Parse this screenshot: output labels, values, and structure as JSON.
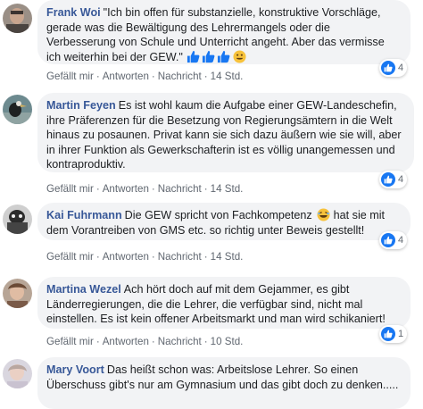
{
  "comments": [
    {
      "author": "Frank Woi",
      "text": "\"Ich bin offen für substanzielle, konstruktive Vorschläge, gerade was die Bewältigung des Lehrermangels oder die Verbesserung von Schule und Unterricht angeht. Aber das vermisse ich weiterhin bei der GEW.\"",
      "like": "Gefällt mir",
      "reply": "Antworten",
      "translate": "Nachricht",
      "time": "14 Std.",
      "reactions": "4"
    },
    {
      "author": "Martin Feyen",
      "text": "Es ist wohl kaum die Aufgabe einer GEW-Landeschefin, ihre Präferenzen für die Besetzung von Regierungsämtern in die Welt hinaus zu posaunen. Privat kann sie sich dazu äußern wie sie will, aber in ihrer Funktion als Gewerkschafterin ist es völlig unangemessen und kontraproduktiv.",
      "like": "Gefällt mir",
      "reply": "Antworten",
      "translate": "Nachricht",
      "time": "14 Std.",
      "reactions": "4"
    },
    {
      "author": "Kai Fuhrmann",
      "text": "Die GEW spricht von Fachkompetenz",
      "text2": "hat sie mit dem Vorantreiben von GMS etc. so richtig unter Beweis gestellt!",
      "like": "Gefällt mir",
      "reply": "Antworten",
      "translate": "Nachricht",
      "time": "14 Std.",
      "reactions": "4"
    },
    {
      "author": "Martina Wezel",
      "text": "Ach hört doch auf mit dem Gejammer, es gibt Länderregierungen, die die Lehrer, die verfügbar sind, nicht mal einstellen. Es ist kein offener Arbeitsmarkt und man wird schikaniert!",
      "like": "Gefällt mir",
      "reply": "Antworten",
      "translate": "Nachricht",
      "time": "10 Std.",
      "reactions": "1"
    },
    {
      "author": "Mary Voort",
      "text": "Das heißt schon was: Arbeitslose Lehrer. So einen Überschuss gibt's nur am Gymnasium und das gibt doch zu denken.....",
      "like": "",
      "reply": "",
      "translate": "",
      "time": "",
      "reactions": ""
    }
  ],
  "colors": {
    "author": "#385898",
    "bubble": "#f2f3f5",
    "like_blue": "#1877f2",
    "meta": "#606770"
  },
  "icons": [
    "like-icon",
    "laughing-emoji-icon",
    "smiley-emoji-icon"
  ]
}
